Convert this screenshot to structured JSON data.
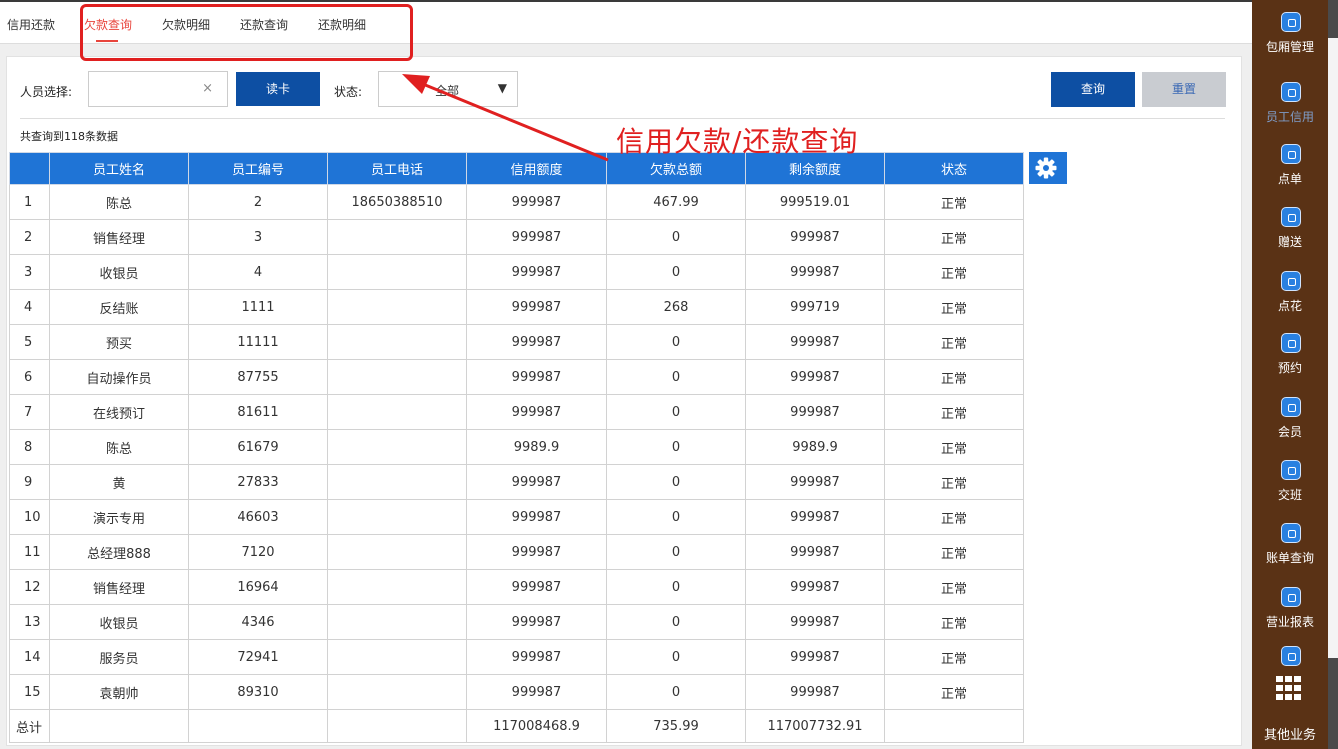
{
  "tabs": [
    {
      "label": "信用还款",
      "active": false
    },
    {
      "label": "欠款查询",
      "active": true
    },
    {
      "label": "欠款明细",
      "active": false
    },
    {
      "label": "还款查询",
      "active": false
    },
    {
      "label": "还款明细",
      "active": false
    }
  ],
  "filters": {
    "person_label": "人员选择:",
    "person_value": "",
    "clear": "×",
    "read_card": "读卡",
    "status_label": "状态:",
    "status_value": "全部",
    "status_arrow": "▼",
    "query": "查询",
    "reset": "重置"
  },
  "result_count": "共查询到118条数据",
  "annotation": "信用欠款/还款查询",
  "table": {
    "headers": [
      "员工姓名",
      "员工编号",
      "员工电话",
      "信用额度",
      "欠款总额",
      "剩余额度",
      "状态"
    ],
    "rows": [
      [
        "1",
        "陈总",
        "2",
        "18650388510",
        "999987",
        "467.99",
        "999519.01",
        "正常"
      ],
      [
        "2",
        "销售经理",
        "3",
        "",
        "999987",
        "0",
        "999987",
        "正常"
      ],
      [
        "3",
        "收银员",
        "4",
        "",
        "999987",
        "0",
        "999987",
        "正常"
      ],
      [
        "4",
        "反结账",
        "1111",
        "",
        "999987",
        "268",
        "999719",
        "正常"
      ],
      [
        "5",
        "预买",
        "11111",
        "",
        "999987",
        "0",
        "999987",
        "正常"
      ],
      [
        "6",
        "自动操作员",
        "87755",
        "",
        "999987",
        "0",
        "999987",
        "正常"
      ],
      [
        "7",
        "在线预订",
        "81611",
        "",
        "999987",
        "0",
        "999987",
        "正常"
      ],
      [
        "8",
        "陈总",
        "61679",
        "",
        "9989.9",
        "0",
        "9989.9",
        "正常"
      ],
      [
        "9",
        "黄",
        "27833",
        "",
        "999987",
        "0",
        "999987",
        "正常"
      ],
      [
        "10",
        "演示专用",
        "46603",
        "",
        "999987",
        "0",
        "999987",
        "正常"
      ],
      [
        "11",
        "总经理888",
        "7120",
        "",
        "999987",
        "0",
        "999987",
        "正常"
      ],
      [
        "12",
        "销售经理",
        "16964",
        "",
        "999987",
        "0",
        "999987",
        "正常"
      ],
      [
        "13",
        "收银员",
        "4346",
        "",
        "999987",
        "0",
        "999987",
        "正常"
      ],
      [
        "14",
        "服务员",
        "72941",
        "",
        "999987",
        "0",
        "999987",
        "正常"
      ],
      [
        "15",
        "袁朝帅",
        "89310",
        "",
        "999987",
        "0",
        "999987",
        "正常"
      ]
    ],
    "total": [
      "总计",
      "",
      "",
      "",
      "117008468.9",
      "735.99",
      "117007732.91",
      ""
    ]
  },
  "sidebar": [
    {
      "label": "包厢管理",
      "icon": "grid-icon"
    },
    {
      "label": "员工信用",
      "icon": "credit-icon",
      "faded": true
    },
    {
      "label": "点单",
      "icon": "order-icon"
    },
    {
      "label": "赠送",
      "icon": "gift-icon"
    },
    {
      "label": "点花",
      "icon": "flower-icon"
    },
    {
      "label": "预约",
      "icon": "reserve-icon"
    },
    {
      "label": "会员",
      "icon": "member-icon"
    },
    {
      "label": "交班",
      "icon": "shift-icon"
    },
    {
      "label": "账单查询",
      "icon": "bill-icon"
    },
    {
      "label": "营业报表",
      "icon": "report-icon"
    },
    {
      "label": "",
      "icon": "extra-icon"
    },
    {
      "label": "其他业务",
      "icon": "apps-icon"
    }
  ],
  "colors": {
    "accent": "#e8453c",
    "header_blue": "#1f74d6",
    "button_blue": "#0d4fa3",
    "sidebar": "#5a3215",
    "annotation_red": "#e02020"
  }
}
